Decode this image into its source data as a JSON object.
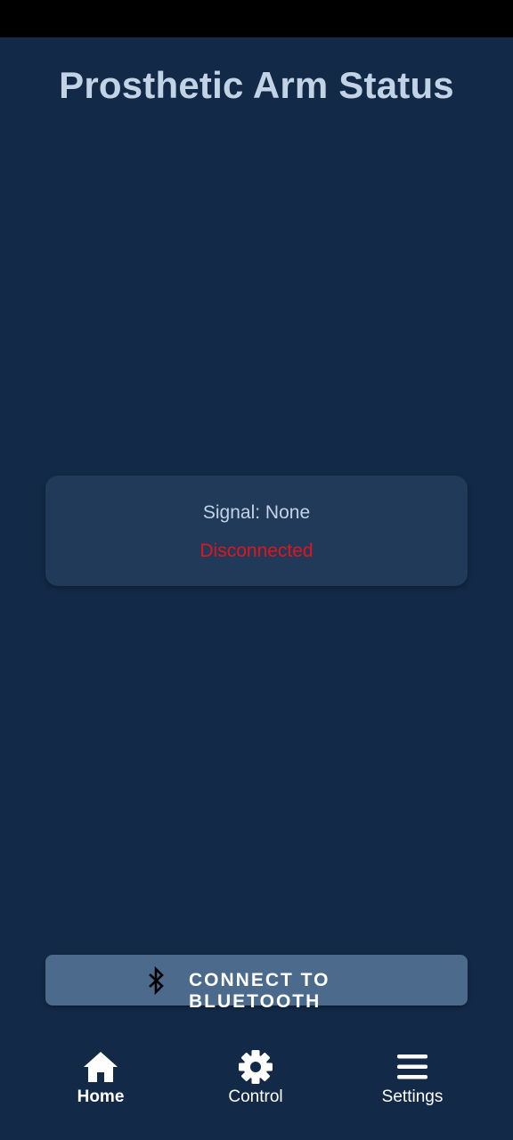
{
  "header": {
    "title": "Prosthetic Arm Status"
  },
  "status_card": {
    "signal": "Signal: None",
    "connection": "Disconnected"
  },
  "connect_button": {
    "label": "CONNECT TO BLUETOOTH",
    "icon": "bluetooth-icon"
  },
  "bottom_nav": {
    "items": [
      {
        "label": "Home",
        "icon": "home-icon",
        "active": true
      },
      {
        "label": "Control",
        "icon": "gear-icon",
        "active": false
      },
      {
        "label": "Settings",
        "icon": "menu-icon",
        "active": false
      }
    ]
  },
  "colors": {
    "background": "#122a47",
    "card": "#213a5a",
    "button": "#4c6a8b",
    "title_text": "#c3d3e6",
    "disconnected": "#e0161e"
  }
}
